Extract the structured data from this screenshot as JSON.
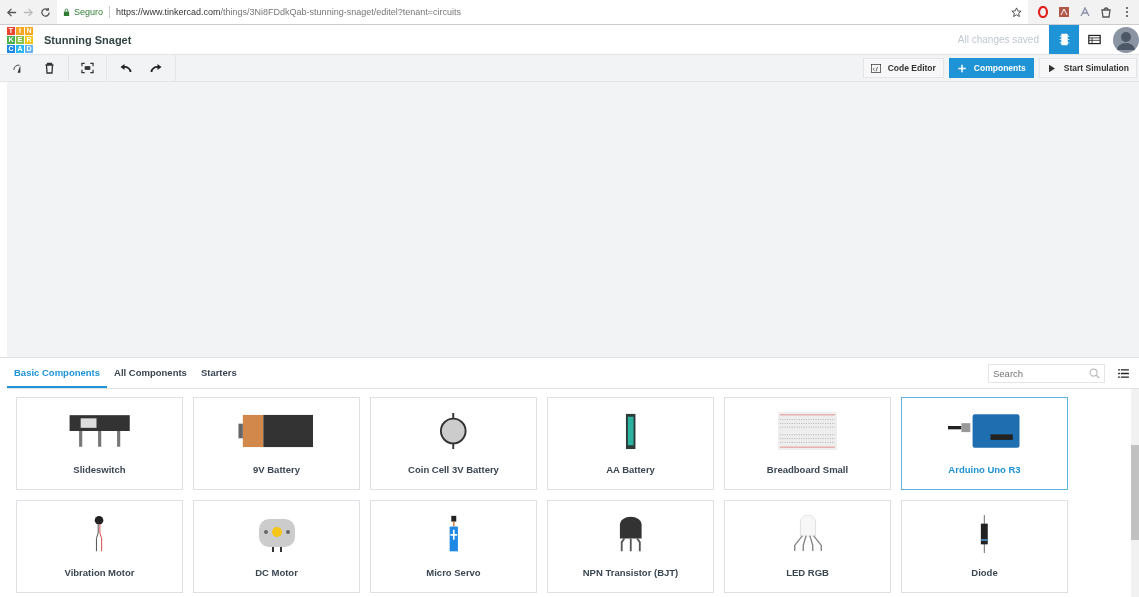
{
  "browser": {
    "secure_label": "Seguro",
    "url_host": "https://www.tinkercad.com",
    "url_path": "/things/3Ni8FDdkQab-stunning-snaget/editel?tenant=circuits"
  },
  "header": {
    "logo_letters": [
      "T",
      "I",
      "N",
      "K",
      "E",
      "R",
      "C",
      "A",
      "D"
    ],
    "title": "Stunning Snaget",
    "save_status": "All changes saved",
    "views": [
      {
        "kind": "circuit",
        "selected": true
      },
      {
        "kind": "schematic",
        "selected": false
      }
    ]
  },
  "toolbar": {
    "code_editor": "Code Editor",
    "components": "Components",
    "start_simulation": "Start Simulation"
  },
  "panel": {
    "tabs": [
      {
        "label": "Basic Components",
        "selected": true
      },
      {
        "label": "All Components",
        "selected": false
      },
      {
        "label": "Starters",
        "selected": false
      }
    ],
    "search": {
      "placeholder": "Search"
    },
    "components": [
      {
        "name": "Slideswitch",
        "kind": "slideswitch",
        "selected": false
      },
      {
        "name": "9V Battery",
        "kind": "battery9v",
        "selected": false
      },
      {
        "name": "Coin Cell 3V Battery",
        "kind": "coincell",
        "selected": false
      },
      {
        "name": "AA Battery",
        "kind": "aa",
        "selected": false
      },
      {
        "name": "Breadboard Small",
        "kind": "breadboard",
        "selected": false
      },
      {
        "name": "Arduino Uno R3",
        "kind": "arduino",
        "selected": true
      },
      {
        "name": "Vibration Motor",
        "kind": "vibration",
        "selected": false
      },
      {
        "name": "DC Motor",
        "kind": "dcmotor",
        "selected": false
      },
      {
        "name": "Micro Servo",
        "kind": "servo",
        "selected": false
      },
      {
        "name": "NPN Transistor (BJT)",
        "kind": "transistor",
        "selected": false
      },
      {
        "name": "LED RGB",
        "kind": "led",
        "selected": false
      },
      {
        "name": "Diode",
        "kind": "diode",
        "selected": false
      }
    ]
  }
}
